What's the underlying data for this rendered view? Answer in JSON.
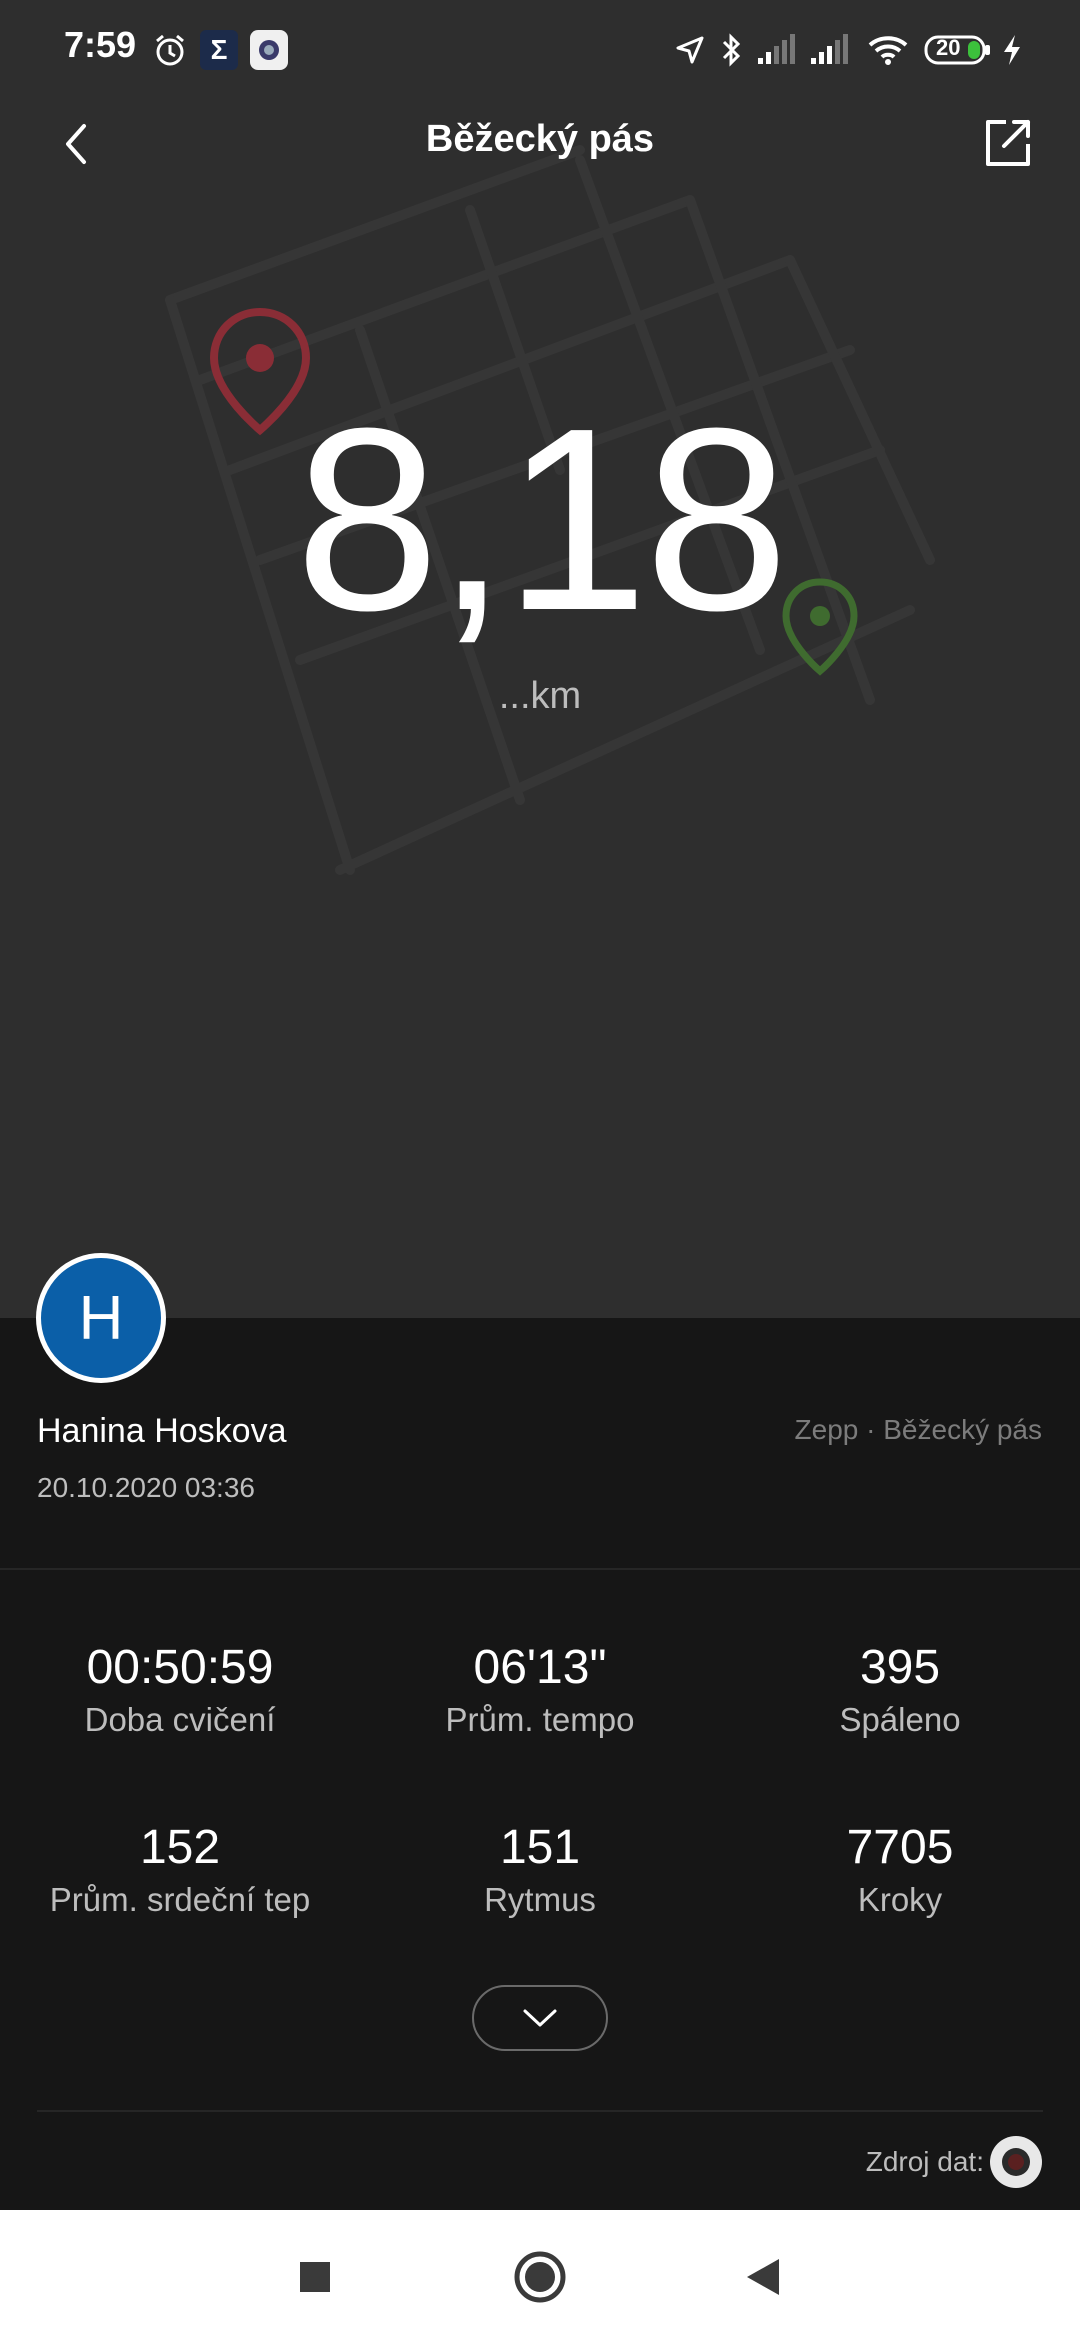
{
  "status_bar": {
    "time": "7:59",
    "battery": "20",
    "icons": [
      "alarm-icon",
      "sigma-app-icon",
      "camera-app-icon",
      "location-icon",
      "bluetooth-icon",
      "signal-icon",
      "signal-icon",
      "wifi-icon",
      "battery-icon",
      "charging-icon"
    ]
  },
  "app_bar": {
    "title": "Běžecký pás",
    "back_icon": "chevron-left-icon",
    "share_icon": "share-icon"
  },
  "summary": {
    "distance": "8,18",
    "unit": "...km"
  },
  "user": {
    "initial": "H",
    "name": "Hanina Hoskova",
    "datetime": "20.10.2020 03:36",
    "source": "Zepp · Běžecký pás",
    "avatar_color": "#0b5fa8"
  },
  "stats": [
    {
      "value": "00:50:59",
      "label": "Doba cvičení"
    },
    {
      "value": "06'13\"",
      "label": "Prům. tempo"
    },
    {
      "value": "395",
      "label": "Spáleno"
    },
    {
      "value": "152",
      "label": "Prům. srdeční tep"
    },
    {
      "value": "151",
      "label": "Rytmus"
    },
    {
      "value": "7705",
      "label": "Kroky"
    }
  ],
  "footer": {
    "data_source_label": "Zdroj dat:"
  },
  "nav": [
    "recent-apps-icon",
    "home-icon",
    "back-triangle-icon"
  ],
  "colors": {
    "hero_bg": "#2e2e2e",
    "panel_bg": "#161616",
    "start_marker": "#8a2d36",
    "end_marker": "#3f6b2f"
  }
}
